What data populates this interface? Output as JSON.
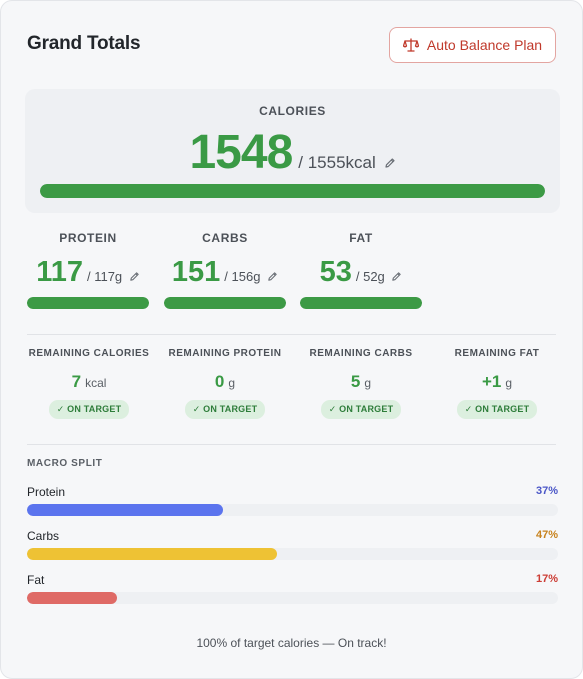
{
  "header": {
    "title": "Grand Totals",
    "balance_button": "Auto Balance Plan",
    "balance_icon": "scale-icon"
  },
  "calories": {
    "label": "CALORIES",
    "value": "1548",
    "target": "/ 1555kcal",
    "progress": 1.0
  },
  "macros": [
    {
      "label": "PROTEIN",
      "value": "117",
      "target": "/ 117g",
      "progress": 1.0
    },
    {
      "label": "CARBS",
      "value": "151",
      "target": "/ 156g",
      "progress": 1.0
    },
    {
      "label": "FAT",
      "value": "53",
      "target": "/ 52g",
      "progress": 1.0
    }
  ],
  "remaining": [
    {
      "label": "REMAINING CALORIES",
      "value": "7",
      "unit": "kcal",
      "badge": "✓ ON TARGET"
    },
    {
      "label": "REMAINING PROTEIN",
      "value": "0",
      "unit": "g",
      "badge": "✓ ON TARGET"
    },
    {
      "label": "REMAINING CARBS",
      "value": "5",
      "unit": "g",
      "badge": "✓ ON TARGET"
    },
    {
      "label": "REMAINING FAT",
      "value": "+1",
      "unit": "g",
      "badge": "✓ ON TARGET"
    }
  ],
  "split": {
    "title": "MACRO SPLIT",
    "rows": [
      {
        "name": "Protein",
        "pct": "37%",
        "fraction": 0.37,
        "color": "#5b74ee",
        "pct_color": "#4a56c7"
      },
      {
        "name": "Carbs",
        "pct": "47%",
        "fraction": 0.47,
        "color": "#eec234",
        "pct_color": "#c7821d"
      },
      {
        "name": "Fat",
        "pct": "17%",
        "fraction": 0.17,
        "color": "#df6a66",
        "pct_color": "#cc3d35"
      }
    ]
  },
  "footer": "100% of target calories — On track!",
  "colors": {
    "accent_green": "#3a9a45",
    "bar_green": "#3c9a45",
    "danger_red": "#c0392b"
  }
}
